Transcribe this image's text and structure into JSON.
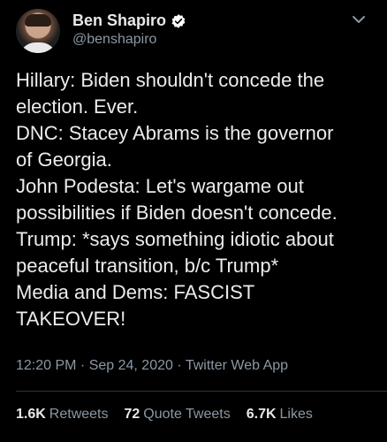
{
  "author": {
    "name": "Ben Shapiro",
    "handle": "@benshapiro"
  },
  "tweet": {
    "lines": [
      "Hillary: Biden shouldn't concede the",
      "election. Ever.",
      "DNC: Stacey Abrams is the governor",
      "of Georgia.",
      "John Podesta: Let's wargame out",
      "possibilities if Biden doesn't concede.",
      "Trump: *says something idiotic about",
      "peaceful transition, b/c Trump*",
      "Media and Dems: FASCIST",
      "TAKEOVER!"
    ],
    "meta": "12:20 PM · Sep 24, 2020 · Twitter Web App"
  },
  "stats": {
    "retweets": {
      "count": "1.6K",
      "label": "Retweets"
    },
    "quotes": {
      "count": "72",
      "label": "Quote Tweets"
    },
    "likes": {
      "count": "6.7K",
      "label": "Likes"
    }
  },
  "colors": {
    "background": "#000000",
    "text": "#ececec",
    "muted": "#8b98a5",
    "verified": "#ffffff"
  },
  "icons": [
    "verified-badge-icon",
    "chevron-down-icon"
  ]
}
